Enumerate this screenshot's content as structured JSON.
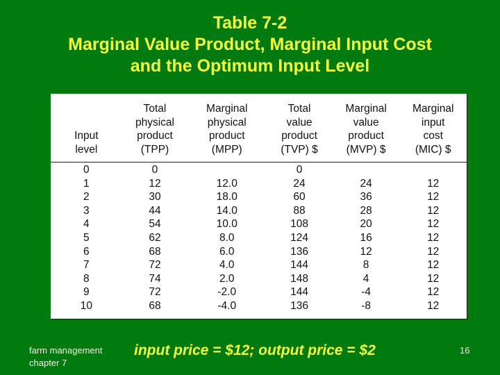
{
  "slide": {
    "title_lines": [
      "Table 7-2",
      "Marginal Value Product, Marginal Input Cost",
      "and the Optimum Input Level"
    ],
    "colors": {
      "background": "#007A0E",
      "title": "#F4FF3C",
      "table_bg": "#FFFFFF"
    }
  },
  "table": {
    "headers": [
      [
        "",
        "",
        "Input",
        "level"
      ],
      [
        "Total",
        "physical",
        "product",
        "(TPP)"
      ],
      [
        "Marginal",
        "physical",
        "product",
        "(MPP)"
      ],
      [
        "Total",
        "value",
        "product",
        "(TVP) $"
      ],
      [
        "Marginal",
        "value",
        "product",
        "(MVP) $"
      ],
      [
        "Marginal",
        "input",
        "cost",
        "(MIC) $"
      ]
    ],
    "rows": [
      [
        "0",
        "0",
        "",
        "0",
        "",
        ""
      ],
      [
        "1",
        "12",
        "12.0",
        "24",
        "24",
        "12"
      ],
      [
        "2",
        "30",
        "18.0",
        "60",
        "36",
        "12"
      ],
      [
        "3",
        "44",
        "14.0",
        "88",
        "28",
        "12"
      ],
      [
        "4",
        "54",
        "10.0",
        "108",
        "20",
        "12"
      ],
      [
        "5",
        "62",
        "8.0",
        "124",
        "16",
        "12"
      ],
      [
        "6",
        "68",
        "6.0",
        "136",
        "12",
        "12"
      ],
      [
        "7",
        "72",
        "4.0",
        "144",
        "8",
        "12"
      ],
      [
        "8",
        "74",
        "2.0",
        "148",
        "4",
        "12"
      ],
      [
        "9",
        "72",
        "-2.0",
        "144",
        "-4",
        "12"
      ],
      [
        "10",
        "68",
        "-4.0",
        "136",
        "-8",
        "12"
      ]
    ]
  },
  "footer": {
    "left_lines": [
      "farm management",
      "chapter 7"
    ],
    "center": "input price = $12; output price = $2",
    "page_number": "16"
  }
}
